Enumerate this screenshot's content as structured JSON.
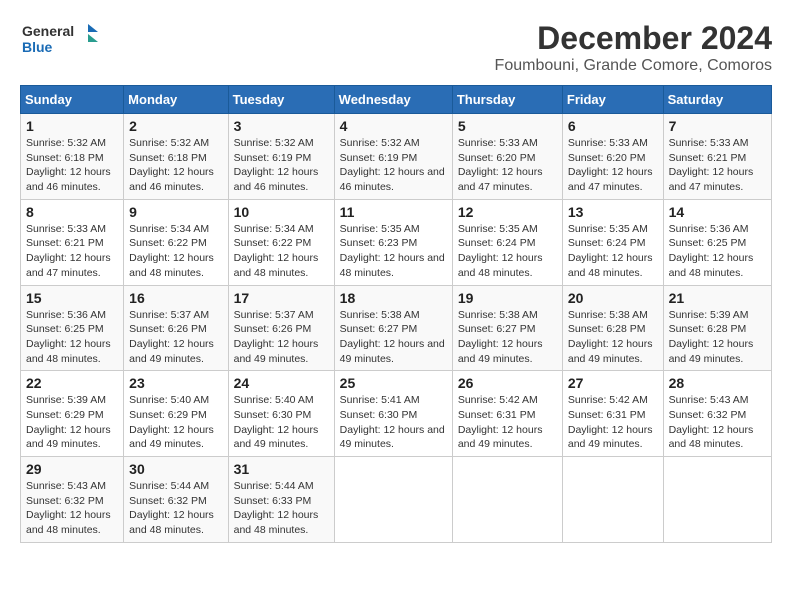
{
  "logo": {
    "line1": "General",
    "line2": "Blue"
  },
  "title": "December 2024",
  "subtitle": "Foumbouni, Grande Comore, Comoros",
  "days_of_week": [
    "Sunday",
    "Monday",
    "Tuesday",
    "Wednesday",
    "Thursday",
    "Friday",
    "Saturday"
  ],
  "weeks": [
    [
      {
        "day": "1",
        "sunrise": "5:32 AM",
        "sunset": "6:18 PM",
        "daylight": "12 hours and 46 minutes."
      },
      {
        "day": "2",
        "sunrise": "5:32 AM",
        "sunset": "6:18 PM",
        "daylight": "12 hours and 46 minutes."
      },
      {
        "day": "3",
        "sunrise": "5:32 AM",
        "sunset": "6:19 PM",
        "daylight": "12 hours and 46 minutes."
      },
      {
        "day": "4",
        "sunrise": "5:32 AM",
        "sunset": "6:19 PM",
        "daylight": "12 hours and 46 minutes."
      },
      {
        "day": "5",
        "sunrise": "5:33 AM",
        "sunset": "6:20 PM",
        "daylight": "12 hours and 47 minutes."
      },
      {
        "day": "6",
        "sunrise": "5:33 AM",
        "sunset": "6:20 PM",
        "daylight": "12 hours and 47 minutes."
      },
      {
        "day": "7",
        "sunrise": "5:33 AM",
        "sunset": "6:21 PM",
        "daylight": "12 hours and 47 minutes."
      }
    ],
    [
      {
        "day": "8",
        "sunrise": "5:33 AM",
        "sunset": "6:21 PM",
        "daylight": "12 hours and 47 minutes."
      },
      {
        "day": "9",
        "sunrise": "5:34 AM",
        "sunset": "6:22 PM",
        "daylight": "12 hours and 48 minutes."
      },
      {
        "day": "10",
        "sunrise": "5:34 AM",
        "sunset": "6:22 PM",
        "daylight": "12 hours and 48 minutes."
      },
      {
        "day": "11",
        "sunrise": "5:35 AM",
        "sunset": "6:23 PM",
        "daylight": "12 hours and 48 minutes."
      },
      {
        "day": "12",
        "sunrise": "5:35 AM",
        "sunset": "6:24 PM",
        "daylight": "12 hours and 48 minutes."
      },
      {
        "day": "13",
        "sunrise": "5:35 AM",
        "sunset": "6:24 PM",
        "daylight": "12 hours and 48 minutes."
      },
      {
        "day": "14",
        "sunrise": "5:36 AM",
        "sunset": "6:25 PM",
        "daylight": "12 hours and 48 minutes."
      }
    ],
    [
      {
        "day": "15",
        "sunrise": "5:36 AM",
        "sunset": "6:25 PM",
        "daylight": "12 hours and 48 minutes."
      },
      {
        "day": "16",
        "sunrise": "5:37 AM",
        "sunset": "6:26 PM",
        "daylight": "12 hours and 49 minutes."
      },
      {
        "day": "17",
        "sunrise": "5:37 AM",
        "sunset": "6:26 PM",
        "daylight": "12 hours and 49 minutes."
      },
      {
        "day": "18",
        "sunrise": "5:38 AM",
        "sunset": "6:27 PM",
        "daylight": "12 hours and 49 minutes."
      },
      {
        "day": "19",
        "sunrise": "5:38 AM",
        "sunset": "6:27 PM",
        "daylight": "12 hours and 49 minutes."
      },
      {
        "day": "20",
        "sunrise": "5:38 AM",
        "sunset": "6:28 PM",
        "daylight": "12 hours and 49 minutes."
      },
      {
        "day": "21",
        "sunrise": "5:39 AM",
        "sunset": "6:28 PM",
        "daylight": "12 hours and 49 minutes."
      }
    ],
    [
      {
        "day": "22",
        "sunrise": "5:39 AM",
        "sunset": "6:29 PM",
        "daylight": "12 hours and 49 minutes."
      },
      {
        "day": "23",
        "sunrise": "5:40 AM",
        "sunset": "6:29 PM",
        "daylight": "12 hours and 49 minutes."
      },
      {
        "day": "24",
        "sunrise": "5:40 AM",
        "sunset": "6:30 PM",
        "daylight": "12 hours and 49 minutes."
      },
      {
        "day": "25",
        "sunrise": "5:41 AM",
        "sunset": "6:30 PM",
        "daylight": "12 hours and 49 minutes."
      },
      {
        "day": "26",
        "sunrise": "5:42 AM",
        "sunset": "6:31 PM",
        "daylight": "12 hours and 49 minutes."
      },
      {
        "day": "27",
        "sunrise": "5:42 AM",
        "sunset": "6:31 PM",
        "daylight": "12 hours and 49 minutes."
      },
      {
        "day": "28",
        "sunrise": "5:43 AM",
        "sunset": "6:32 PM",
        "daylight": "12 hours and 48 minutes."
      }
    ],
    [
      {
        "day": "29",
        "sunrise": "5:43 AM",
        "sunset": "6:32 PM",
        "daylight": "12 hours and 48 minutes."
      },
      {
        "day": "30",
        "sunrise": "5:44 AM",
        "sunset": "6:32 PM",
        "daylight": "12 hours and 48 minutes."
      },
      {
        "day": "31",
        "sunrise": "5:44 AM",
        "sunset": "6:33 PM",
        "daylight": "12 hours and 48 minutes."
      },
      null,
      null,
      null,
      null
    ]
  ]
}
